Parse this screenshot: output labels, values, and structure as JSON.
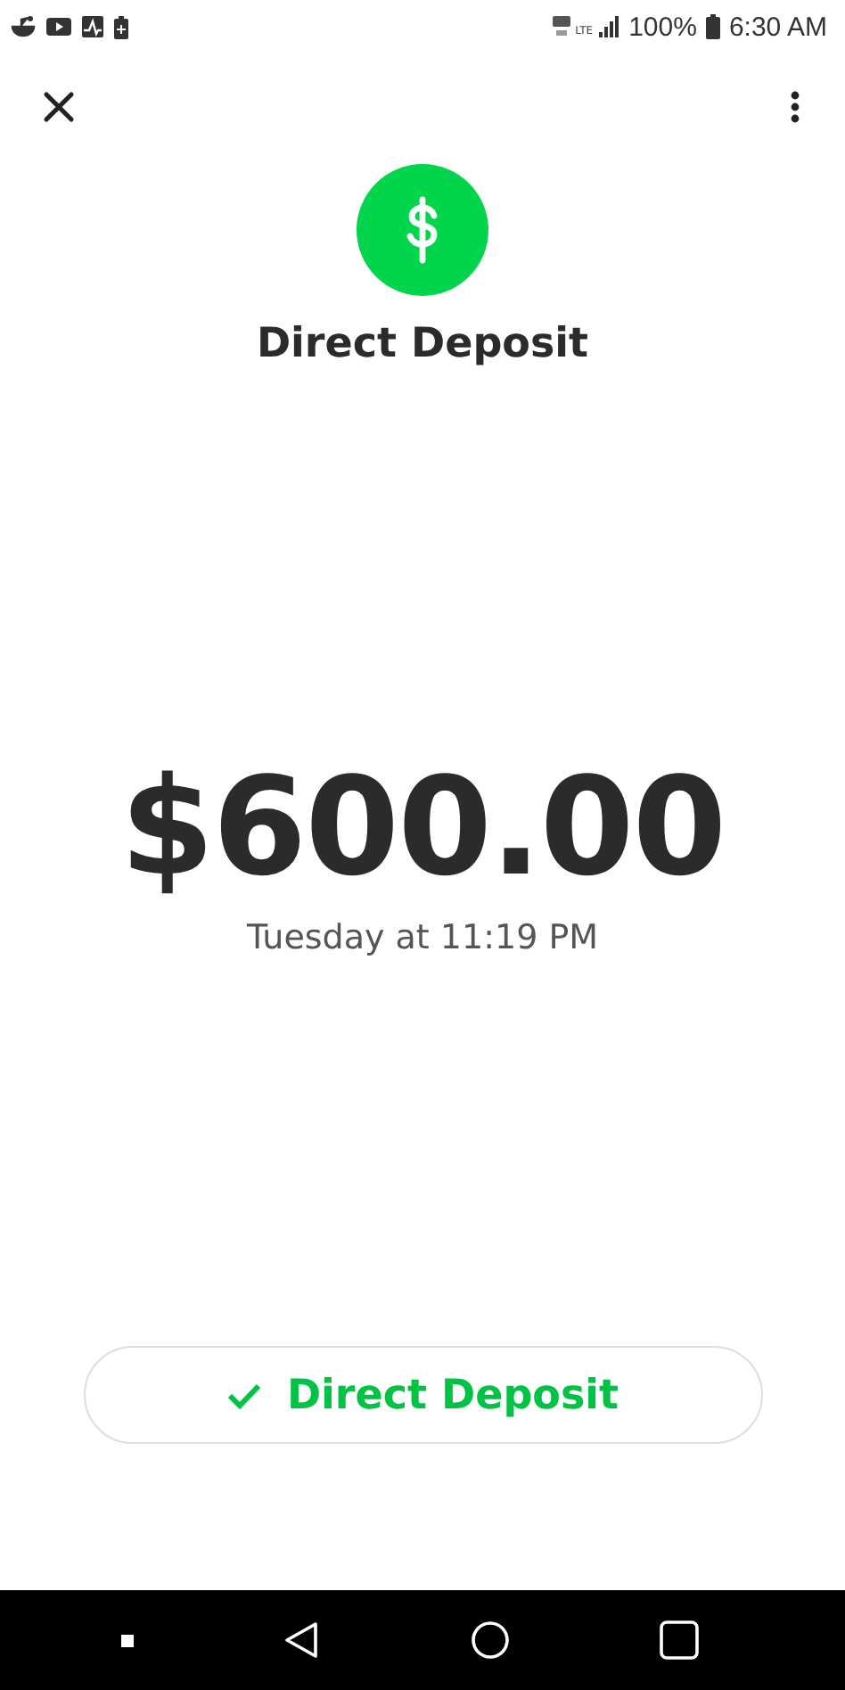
{
  "status_bar": {
    "network": "LTE",
    "battery": "100%",
    "time": "6:30 AM"
  },
  "header": {
    "title": "Direct Deposit"
  },
  "amount": "$600.00",
  "date": "Tuesday at 11:19 PM",
  "action_button": {
    "label": "Direct Deposit",
    "checked": true
  }
}
